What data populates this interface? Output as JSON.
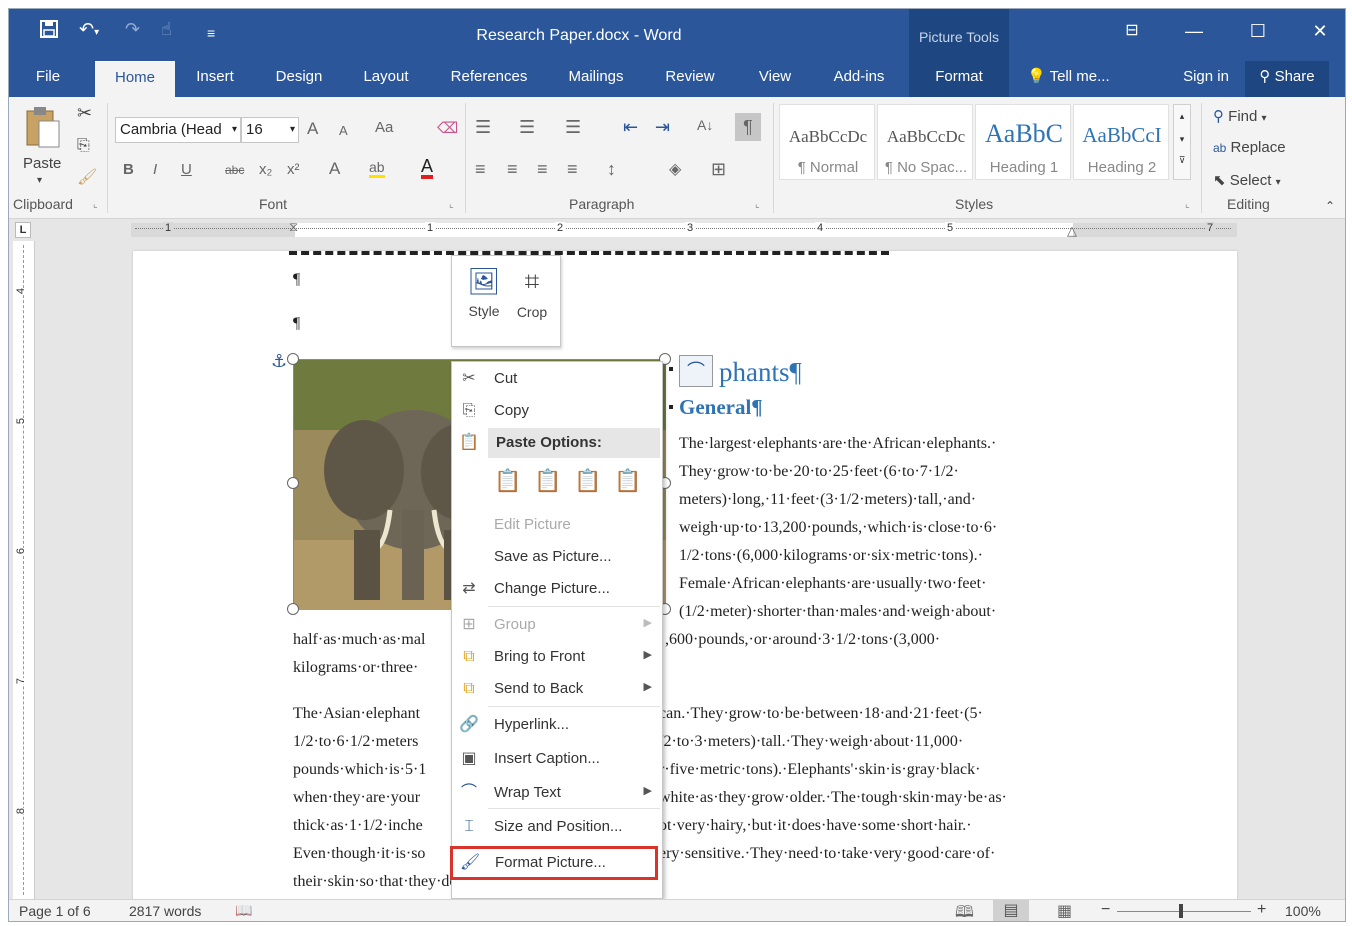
{
  "titlebar": {
    "title": "Research Paper.docx - Word",
    "context_group": "Picture Tools",
    "icons": [
      "save-icon",
      "undo-icon",
      "redo-icon",
      "touch-mode-icon",
      "customize-qat-icon",
      "ribbon-display-icon",
      "minimize-icon",
      "maximize-icon",
      "close-icon"
    ]
  },
  "tabs": {
    "file": "File",
    "home": "Home",
    "insert": "Insert",
    "design": "Design",
    "layout": "Layout",
    "references": "References",
    "mailings": "Mailings",
    "review": "Review",
    "view": "View",
    "addins": "Add-ins",
    "format": "Format",
    "tellme": "Tell me...",
    "signin": "Sign in",
    "share": "Share"
  },
  "ribbon": {
    "clipboard": {
      "paste": "Paste",
      "label": "Clipboard"
    },
    "font": {
      "name": "Cambria (Head",
      "size": "16",
      "grow": "A",
      "shrink": "A",
      "case": "Aa",
      "bold": "B",
      "italic": "I",
      "underline": "U",
      "strike": "abc",
      "sub": "x₂",
      "sup": "x²",
      "effects": "A",
      "highlight": "ab",
      "color": "A",
      "label": "Font"
    },
    "paragraph": {
      "label": "Paragraph",
      "sort": "A↓",
      "pilcrow": "¶"
    },
    "styles": {
      "label": "Styles",
      "items": [
        {
          "preview": "AaBbCcDc",
          "name": "¶ Normal"
        },
        {
          "preview": "AaBbCcDc",
          "name": "¶ No Spac..."
        },
        {
          "preview": "AaBbC",
          "name": "Heading 1"
        },
        {
          "preview": "AaBbCcI",
          "name": "Heading 2"
        }
      ]
    },
    "editing": {
      "find": "Find",
      "replace": "Replace",
      "select": "Select",
      "label": "Editing"
    }
  },
  "ruler": {
    "h_numbers": [
      "1",
      "1",
      "2",
      "3",
      "4",
      "5",
      "7"
    ],
    "v_numbers": [
      "4",
      "5",
      "6",
      "7",
      "8"
    ],
    "corner": "L"
  },
  "document": {
    "pilcrow1": "¶",
    "pilcrow2": "¶",
    "heading1": "phants¶",
    "heading2": "General¶",
    "para_right": [
      "The·largest·elephants·are·the·African·elephants.·",
      "They·grow·to·be·20·to·25·feet·(6·to·7·1/2·",
      "meters)·long,·11·feet·(3·1/2·meters)·tall,·and·",
      "weigh·up·to·13,200·pounds,·which·is·close·to·6·",
      "1/2·tons·(6,000·kilograms·or·six·metric·tons).·",
      "Female·African·elephants·are·usually·two·feet·",
      "(1/2·meter)·shorter·than·males·and·weigh·about·"
    ],
    "para1_left": [
      "half·as·much·as·mal",
      "kilograms·or·three·"
    ],
    "para1_right": [
      ",600·pounds,·or·around·3·1/2·tons·(3,000·"
    ],
    "para2_left": [
      "The·Asian·elephant",
      "1/2·to·6·1/2·meters",
      "pounds·which·is·5·1",
      "when·they·are·your",
      "thick·as·1·1/2·inche",
      "Even·though·it·is·so"
    ],
    "para2_right": [
      "can.·They·grow·to·be·between·18·and·21·feet·(5·",
      "/2·to·3·meters)·tall.·They·weigh·about·11,000·",
      "r·five·metric·tons).·Elephants'·skin·is·gray·black·",
      "white·as·they·grow·older.·The·tough·skin·may·be·as·",
      "ot·very·hairy,·but·it·does·have·some·short·hair.·",
      "ery·sensitive.·They·need·to·take·very·good·care·of·"
    ],
    "last_line": "their·skin·so·that·they·do·not·get·diseases·or·parasites.·¶"
  },
  "mini_toolbar": {
    "style": "Style",
    "crop": "Crop"
  },
  "context_menu": {
    "cut": "Cut",
    "copy": "Copy",
    "paste_options": "Paste Options:",
    "edit_picture": "Edit Picture",
    "save_as_picture": "Save as Picture...",
    "change_picture": "Change Picture...",
    "group": "Group",
    "bring_to_front": "Bring to Front",
    "send_to_back": "Send to Back",
    "hyperlink": "Hyperlink...",
    "insert_caption": "Insert Caption...",
    "wrap_text": "Wrap Text",
    "size_and_position": "Size and Position...",
    "format_picture": "Format Picture..."
  },
  "statusbar": {
    "page": "Page 1 of 6",
    "words": "2817 words",
    "zoom": "100%"
  },
  "colors": {
    "accent": "#2b579a",
    "highlight_box": "#d9332e",
    "heading": "#2e74b5"
  }
}
